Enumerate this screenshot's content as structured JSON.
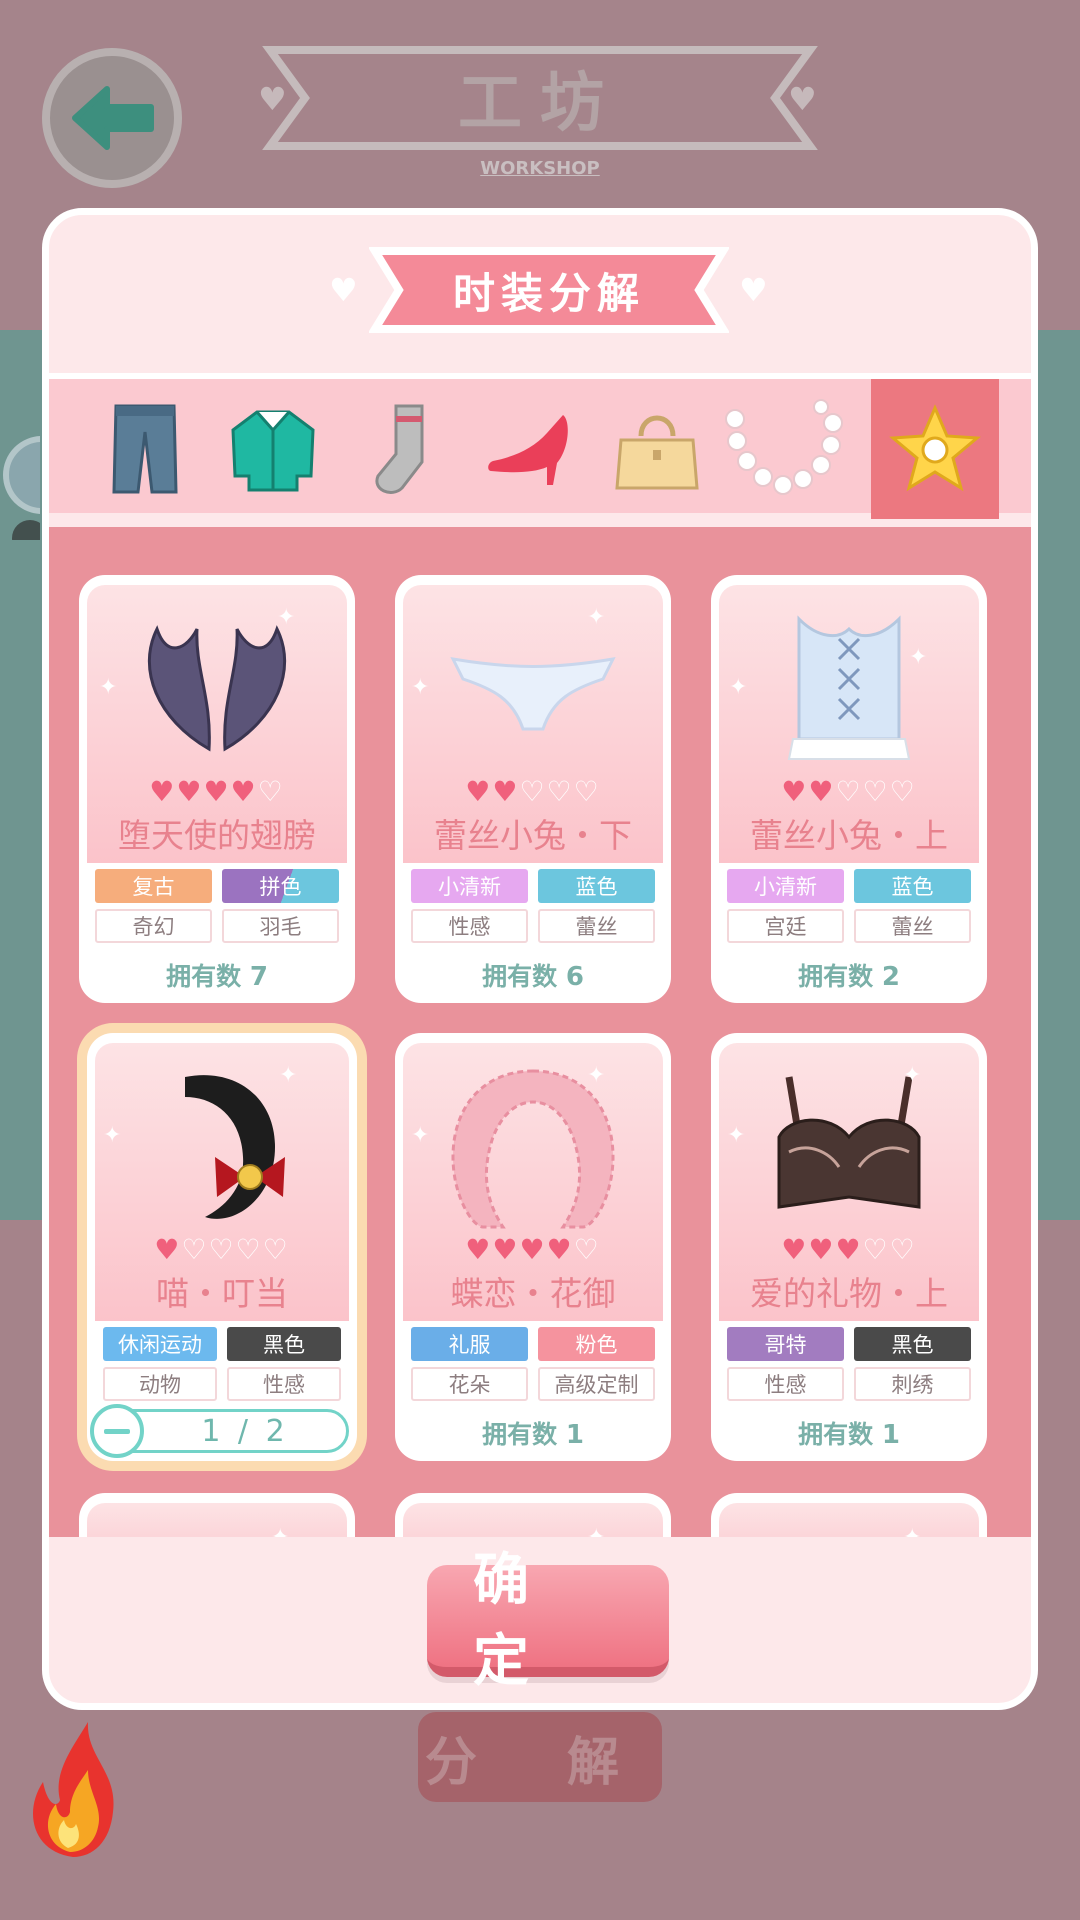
{
  "header": {
    "title": "工坊",
    "subtitle": "WORKSHOP"
  },
  "background_button": {
    "label": "分 解"
  },
  "modal": {
    "title": "时装分解",
    "confirm_label": "确 定"
  },
  "tabs": [
    {
      "icon": "dress-icon",
      "active": false
    },
    {
      "icon": "pants-icon",
      "active": false
    },
    {
      "icon": "coat-icon",
      "active": false
    },
    {
      "icon": "socks-icon",
      "active": false
    },
    {
      "icon": "high-heel-icon",
      "active": false
    },
    {
      "icon": "handbag-icon",
      "active": false
    },
    {
      "icon": "pearl-necklace-icon",
      "active": false
    },
    {
      "icon": "star-badge-icon",
      "active": true
    }
  ],
  "items": [
    {
      "name": "堕天使的翅膀",
      "stars": 3.5,
      "tags": [
        "复古",
        "拼色",
        "奇幻",
        "羽毛"
      ],
      "owned_label": "拥有数",
      "owned": "7",
      "icon": "dark-wings-icon"
    },
    {
      "name": "蕾丝小兔・下",
      "stars": 2,
      "tags": [
        "小清新",
        "蓝色",
        "性感",
        "蕾丝"
      ],
      "owned_label": "拥有数",
      "owned": "6",
      "icon": "lace-panties-icon"
    },
    {
      "name": "蕾丝小兔・上",
      "stars": 2,
      "tags": [
        "小清新",
        "蓝色",
        "宫廷",
        "蕾丝"
      ],
      "owned_label": "拥有数",
      "owned": "2",
      "icon": "lace-corset-icon"
    },
    {
      "name": "喵・叮当",
      "stars": 1,
      "tags": [
        "休闲运动",
        "黑色",
        "动物",
        "性感"
      ],
      "selected": true,
      "stepper": "1 / 2",
      "icon": "cat-tail-icon"
    },
    {
      "name": "蝶恋・花御",
      "stars": 4,
      "tags": [
        "礼服",
        "粉色",
        "花朵",
        "高级定制"
      ],
      "owned_label": "拥有数",
      "owned": "1",
      "icon": "flower-wreath-icon"
    },
    {
      "name": "爱的礼物・上",
      "stars": 2.5,
      "tags": [
        "哥特",
        "黑色",
        "性感",
        "刺绣"
      ],
      "owned_label": "拥有数",
      "owned": "1",
      "icon": "lace-bra-icon"
    }
  ],
  "tag_colors": {
    "复古": "#f6ad7c",
    "拼色": "#8b7fd0",
    "小清新": "#e6a8f0",
    "蓝色": "#6cc6de",
    "休闲运动": "#6cb9ee",
    "黑色": "#4a4a4a",
    "礼服": "#6aaee8",
    "粉色": "#f5939e",
    "哥特": "#a27cc0"
  }
}
